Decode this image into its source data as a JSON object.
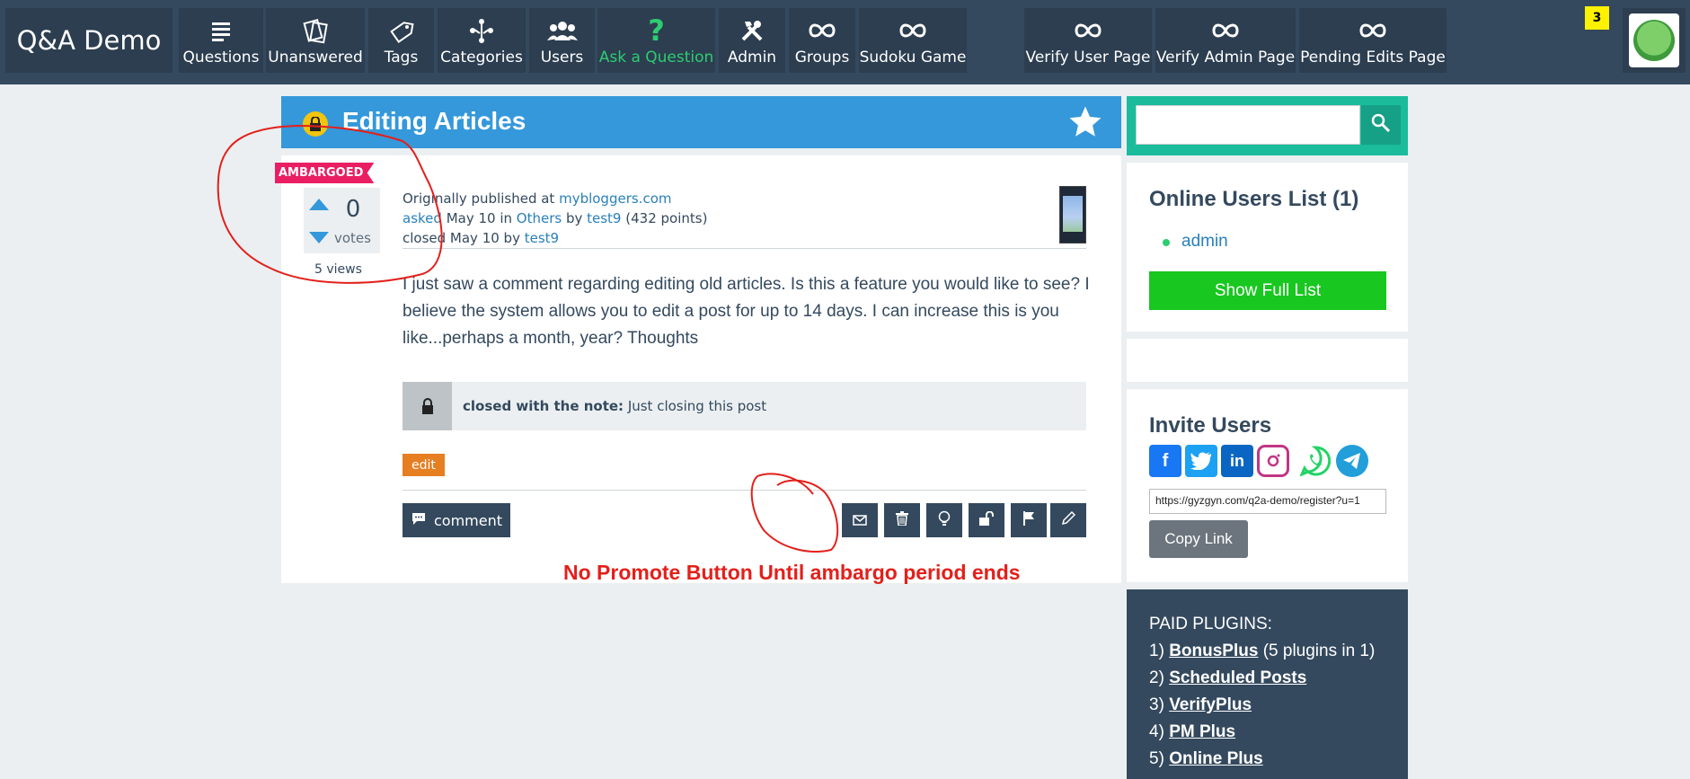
{
  "nav": {
    "logo": "Q&A Demo",
    "items": [
      {
        "label": "Questions"
      },
      {
        "label": "Unanswered"
      },
      {
        "label": "Tags"
      },
      {
        "label": "Categories"
      },
      {
        "label": "Users"
      },
      {
        "label": "Ask a Question"
      },
      {
        "label": "Admin"
      },
      {
        "label": "Groups"
      },
      {
        "label": "Sudoku Game"
      },
      {
        "label": "Verify User Page"
      },
      {
        "label": "Verify Admin Page"
      },
      {
        "label": "Pending Edits Page"
      }
    ],
    "notification_count": "3"
  },
  "question": {
    "title": "Editing Articles",
    "status_label": "AMBARGOED",
    "votes": "0",
    "votes_label": "votes",
    "views": "5 views",
    "meta": {
      "published_prefix": "Originally published at ",
      "published_site": "mybloggers.com",
      "asked": "asked",
      "asked_date": " May 10 in ",
      "category": "Others",
      "by": " by ",
      "author": "test9",
      "points": " (432 points)",
      "closed": "closed May 10 by ",
      "closed_by": "test9"
    },
    "body": "I just saw a comment regarding editing old articles. Is this a feature you would like to see? I believe the system allows you to edit a post for up to 14 days. I can increase this is you like...perhaps a month, year? Thoughts",
    "closed_note_label": "closed with the note:",
    "closed_note": " Just closing this post",
    "tag": "edit",
    "comment_label": "comment"
  },
  "annotation": "No Promote Button Until ambargo period ends",
  "sidebar": {
    "online_title": "Online Users List (1)",
    "online_user": "admin",
    "show_full": "Show Full List",
    "invite_title": "Invite Users",
    "invite_link": "https://gyzgyn.com/q2a-demo/register?u=1",
    "copy_link": "Copy Link",
    "paid_title": "PAID PLUGINS:",
    "plugins": [
      {
        "num": "1) ",
        "name": "BonusPlus",
        "extra": " (5 plugins in 1)"
      },
      {
        "num": "2) ",
        "name": "Scheduled Posts",
        "extra": ""
      },
      {
        "num": "3) ",
        "name": "VerifyPlus",
        "extra": ""
      },
      {
        "num": "4) ",
        "name": "PM Plus",
        "extra": ""
      },
      {
        "num": "5) ",
        "name": "Online Plus",
        "extra": ""
      }
    ]
  },
  "colors": {
    "nav_bg": "#34495e",
    "title_bar": "#3498db",
    "accent_green": "#18c71f",
    "search_teal": "#1abc9c",
    "annotation_red": "#e3201b",
    "ambargo_pink": "#e91e63",
    "tag_orange": "#e67e22"
  }
}
